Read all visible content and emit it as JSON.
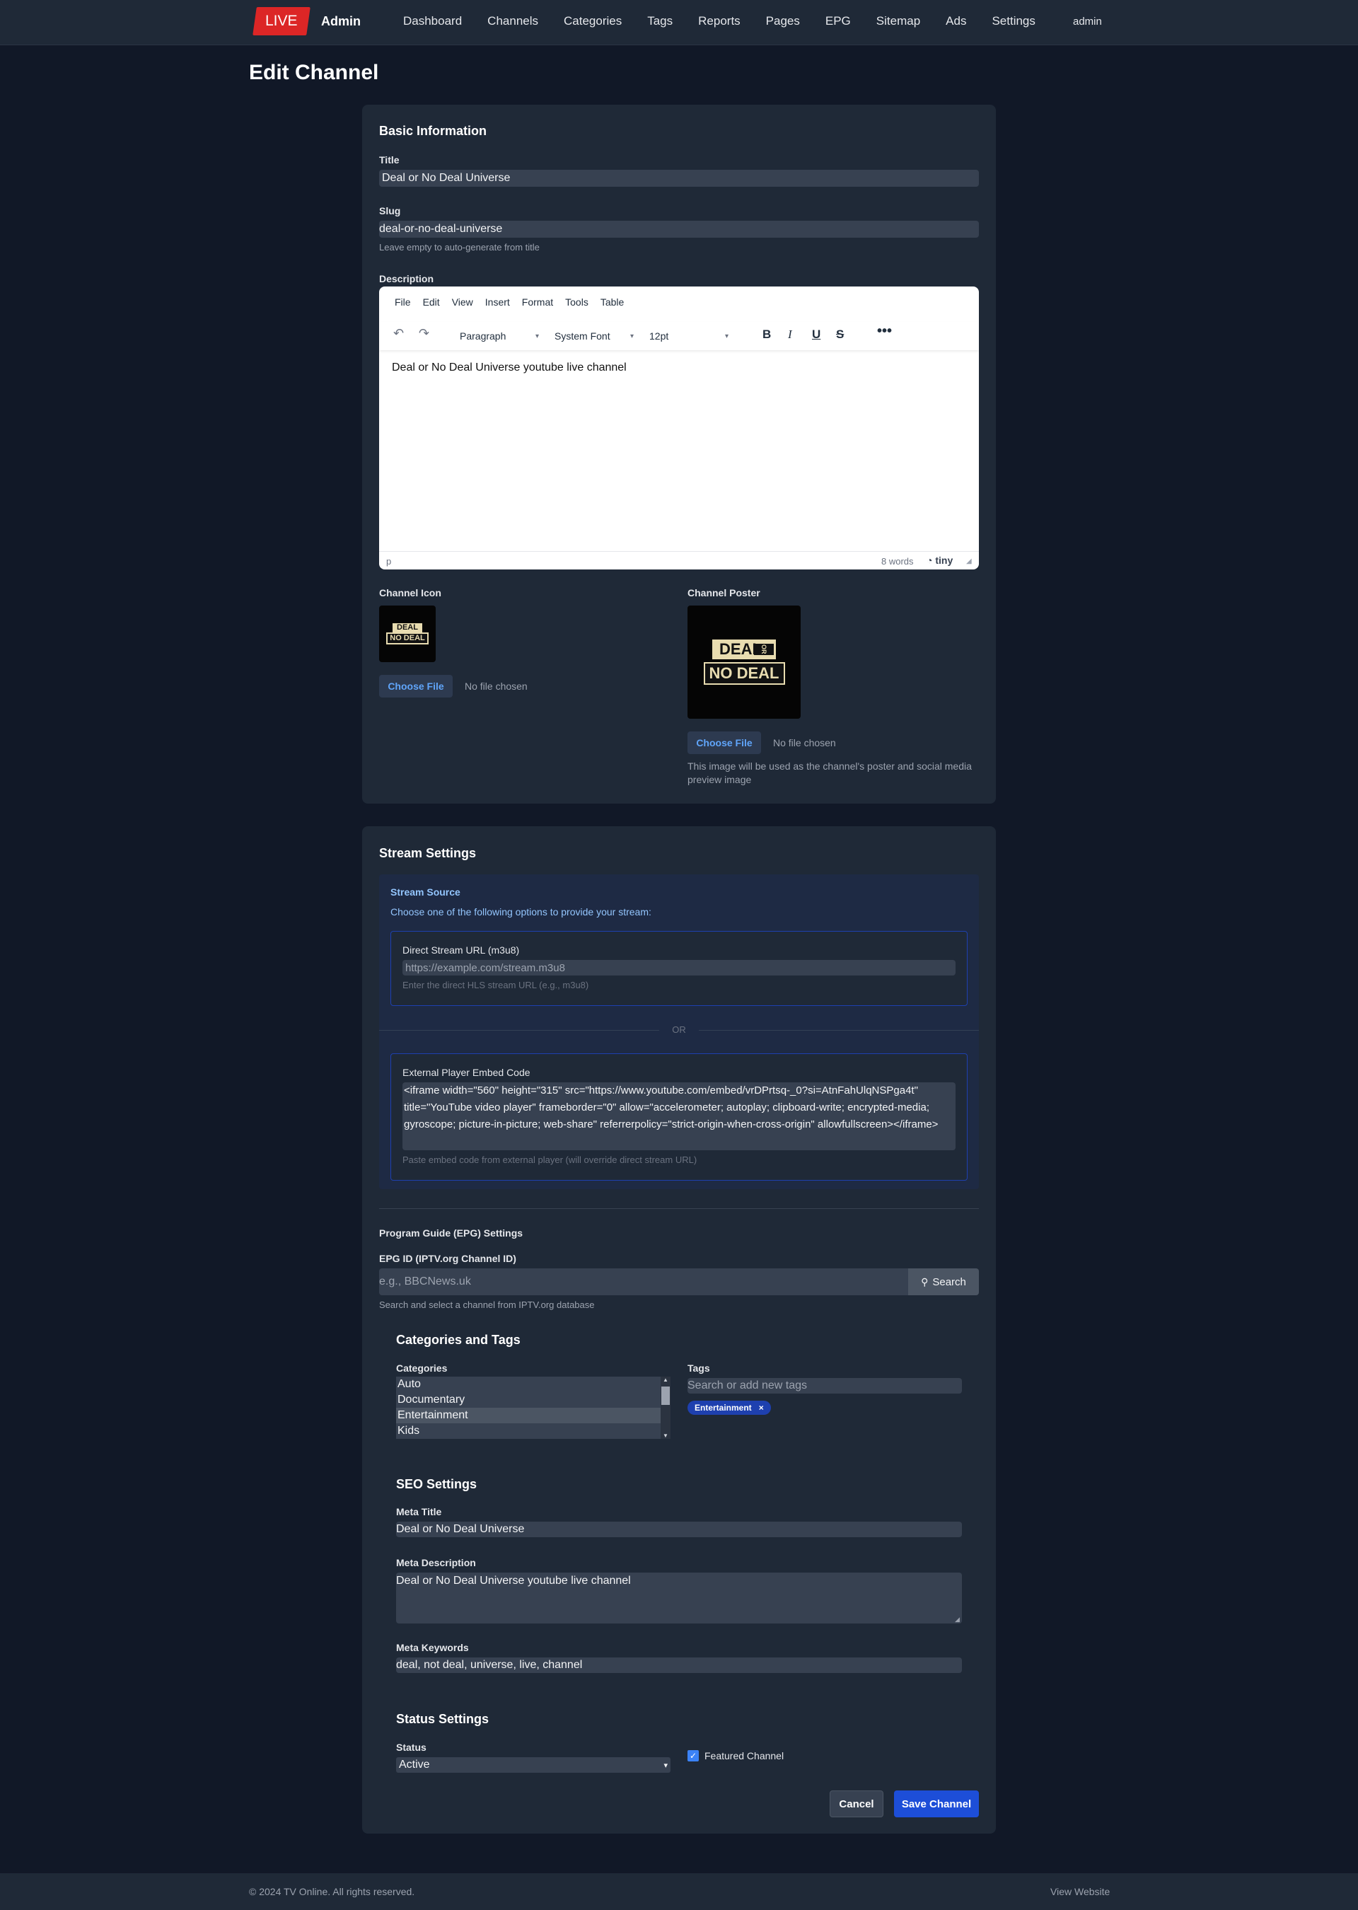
{
  "nav": {
    "logo": "LIVE",
    "brand": "Admin",
    "links": [
      "Dashboard",
      "Channels",
      "Categories",
      "Tags",
      "Reports",
      "Pages",
      "EPG",
      "Sitemap",
      "Ads",
      "Settings"
    ],
    "user": "admin"
  },
  "page_title": "Edit Channel",
  "basic": {
    "heading": "Basic Information",
    "title_label": "Title",
    "title_value": "Deal or No Deal Universe",
    "slug_label": "Slug",
    "slug_value": "deal-or-no-deal-universe",
    "slug_hint": "Leave empty to auto-generate from title",
    "description_label": "Description"
  },
  "editor": {
    "menus": [
      "File",
      "Edit",
      "View",
      "Insert",
      "Format",
      "Tools",
      "Table"
    ],
    "block_format": "Paragraph",
    "font": "System Font",
    "size": "12pt",
    "content": "Deal or No Deal Universe youtube live channel",
    "path": "p",
    "word_count": "8 words",
    "brand": "tiny"
  },
  "media": {
    "icon_label": "Channel Icon",
    "poster_label": "Channel Poster",
    "choose_file": "Choose File",
    "no_file": "No file chosen",
    "poster_hint": "This image will be used as the channel's poster and social media preview image",
    "logo_line1": "DEAL",
    "logo_or": "OR",
    "logo_line2": "NO DEAL"
  },
  "stream": {
    "heading": "Stream Settings",
    "source_title": "Stream Source",
    "source_sub": "Choose one of the following options to provide your stream:",
    "direct_label": "Direct Stream URL (m3u8)",
    "direct_placeholder": "https://example.com/stream.m3u8",
    "direct_hint": "Enter the direct HLS stream URL (e.g., m3u8)",
    "or": "OR",
    "embed_label": "External Player Embed Code",
    "embed_value": "<iframe width=\"560\" height=\"315\" src=\"https://www.youtube.com/embed/vrDPrtsq-_0?si=AtnFahUlqNSPga4t\" title=\"YouTube video player\" frameborder=\"0\" allow=\"accelerometer; autoplay; clipboard-write; encrypted-media; gyroscope; picture-in-picture; web-share\" referrerpolicy=\"strict-origin-when-cross-origin\" allowfullscreen></iframe>",
    "embed_hint": "Paste embed code from external player (will override direct stream URL)"
  },
  "epg": {
    "heading": "Program Guide (EPG) Settings",
    "id_label": "EPG ID (IPTV.org Channel ID)",
    "id_placeholder": "e.g., BBCNews.uk",
    "search_label": "Search",
    "hint": "Search and select a channel from IPTV.org database"
  },
  "taxonomy": {
    "heading": "Categories and Tags",
    "categories_label": "Categories",
    "categories": [
      "Auto",
      "Documentary",
      "Entertainment",
      "Kids"
    ],
    "selected_category": "Entertainment",
    "tags_label": "Tags",
    "tags_placeholder": "Search or add new tags",
    "tags": [
      "Entertainment"
    ]
  },
  "seo": {
    "heading": "SEO Settings",
    "meta_title_label": "Meta Title",
    "meta_title_value": "Deal or No Deal Universe",
    "meta_desc_label": "Meta Description",
    "meta_desc_value": "Deal or No Deal Universe youtube live channel",
    "meta_keywords_label": "Meta Keywords",
    "meta_keywords_value": "deal, not deal, universe, live, channel"
  },
  "status": {
    "heading": "Status Settings",
    "status_label": "Status",
    "status_value": "Active",
    "featured_label": "Featured Channel",
    "featured_checked": true
  },
  "actions": {
    "cancel": "Cancel",
    "save": "Save Channel"
  },
  "footer": {
    "copyright": "© 2024 TV Online. All rights reserved.",
    "view_website": "View Website"
  },
  "colors": {
    "background": "#111827",
    "card": "#1f2937",
    "primary": "#1d4ed8",
    "live_red": "#dc2626"
  }
}
